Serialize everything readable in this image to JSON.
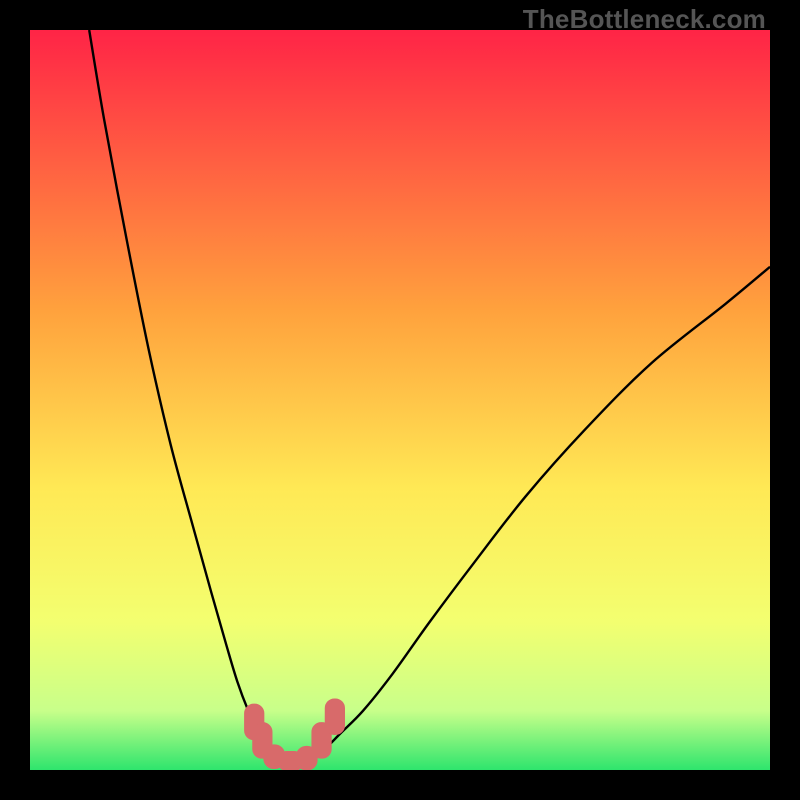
{
  "watermark": "TheBottleneck.com",
  "colors": {
    "frame": "#000000",
    "gradient_top": "#FF2446",
    "gradient_mid1": "#FFA23D",
    "gradient_mid2": "#FFE955",
    "gradient_mid3": "#F3FF70",
    "gradient_band": "#C8FF8A",
    "gradient_bottom": "#2EE56D",
    "curve": "#000000",
    "marker_fill": "#D86A6A",
    "marker_stroke": "#D86A6A"
  },
  "chart_data": {
    "type": "line",
    "title": "",
    "xlabel": "",
    "ylabel": "",
    "xlim": [
      0,
      100
    ],
    "ylim": [
      0,
      100
    ],
    "series": [
      {
        "name": "left-curve",
        "x": [
          8,
          10,
          13,
          16,
          19,
          22,
          24.5,
          26.5,
          28,
          29.5,
          30.5,
          31.5,
          32.5,
          33.5
        ],
        "y": [
          100,
          88,
          72,
          57,
          44,
          33,
          24,
          17,
          12,
          8,
          6,
          4,
          3,
          2
        ]
      },
      {
        "name": "right-curve",
        "x": [
          38.5,
          40,
          42,
          45,
          49,
          54,
          60,
          67,
          75,
          84,
          94,
          100
        ],
        "y": [
          2,
          3,
          5,
          8,
          13,
          20,
          28,
          37,
          46,
          55,
          63,
          68
        ]
      }
    ],
    "markers": [
      {
        "shape": "rounded-rect",
        "cx": 30.3,
        "cy": 6.5,
        "w": 2.6,
        "h": 4.8
      },
      {
        "shape": "rounded-rect",
        "cx": 31.4,
        "cy": 4.0,
        "w": 2.6,
        "h": 4.8
      },
      {
        "shape": "rounded-rect",
        "cx": 33.0,
        "cy": 1.8,
        "w": 2.8,
        "h": 3.2
      },
      {
        "shape": "rounded-rect",
        "cx": 35.2,
        "cy": 1.2,
        "w": 3.4,
        "h": 2.6
      },
      {
        "shape": "rounded-rect",
        "cx": 37.4,
        "cy": 1.6,
        "w": 2.8,
        "h": 3.2
      },
      {
        "shape": "rounded-rect",
        "cx": 39.4,
        "cy": 4.0,
        "w": 2.6,
        "h": 4.8
      },
      {
        "shape": "rounded-rect",
        "cx": 41.2,
        "cy": 7.2,
        "w": 2.6,
        "h": 4.8
      }
    ]
  }
}
